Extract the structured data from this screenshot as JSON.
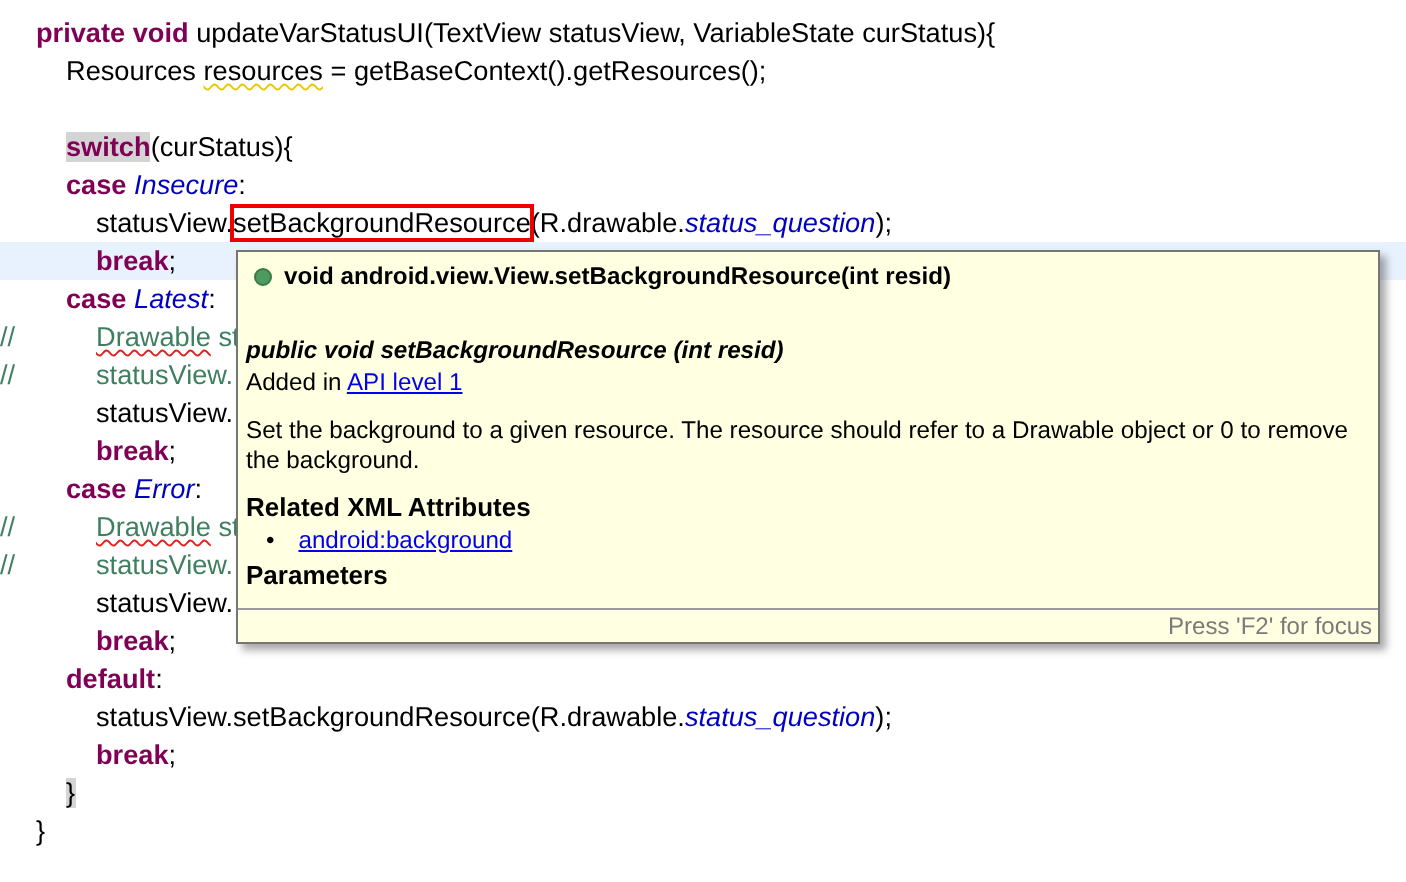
{
  "editor": {
    "lines": [
      {
        "current": false,
        "segments": [
          {
            "kind": "keyword",
            "text": "private void"
          },
          {
            "kind": "plain",
            "text": " updateVarStatusUI(TextView statusView, VariableState curStatus){"
          }
        ],
        "children": [
          {
            "current": false,
            "segments": [
              {
                "kind": "plain",
                "text": "Resources "
              },
              {
                "kind": "plain",
                "text": "resources",
                "warning": true
              },
              {
                "kind": "plain",
                "text": " = getBaseContext().getResources();"
              }
            ]
          },
          {
            "current": false
          },
          {
            "current": false,
            "segments": [
              {
                "kind": "keyword",
                "text": "switch",
                "highlighted": true
              },
              {
                "kind": "plain",
                "text": "(curStatus){"
              }
            ]
          },
          {
            "current": false,
            "segments": [
              {
                "kind": "keyword",
                "text": "case "
              },
              {
                "kind": "constant",
                "text": "Insecure"
              },
              {
                "kind": "plain",
                "text": ":"
              }
            ],
            "children": [
              {
                "current": false,
                "segments": [
                  {
                    "kind": "plain",
                    "text": "statusView."
                  },
                  {
                    "kind": "plain",
                    "text": "setBackgroundResource",
                    "boxed": true
                  },
                  {
                    "kind": "plain",
                    "text": "(R.drawable."
                  },
                  {
                    "kind": "constant",
                    "text": "status_question"
                  },
                  {
                    "kind": "plain",
                    "text": ");"
                  }
                ]
              },
              {
                "current": true,
                "segments": [
                  {
                    "kind": "keyword",
                    "text": "break"
                  },
                  {
                    "kind": "plain",
                    "text": ";"
                  }
                ]
              }
            ]
          },
          {
            "current": false,
            "segments": [
              {
                "kind": "keyword",
                "text": "case "
              },
              {
                "kind": "constant",
                "text": "Latest"
              },
              {
                "kind": "plain",
                "text": ":"
              }
            ],
            "children": [
              {
                "current": false,
                "prefix": "//",
                "segments": [
                  {
                    "kind": "comment",
                    "text": "Drawable",
                    "misspelled": true
                  },
                  {
                    "kind": "comment",
                    "text": " st"
                  }
                ]
              },
              {
                "current": false,
                "prefix": "//",
                "segments": [
                  {
                    "kind": "comment",
                    "text": "statusView."
                  }
                ]
              },
              {
                "current": false,
                "segments": [
                  {
                    "kind": "plain",
                    "text": "statusView."
                  }
                ]
              },
              {
                "current": false,
                "segments": [
                  {
                    "kind": "keyword",
                    "text": "break"
                  },
                  {
                    "kind": "plain",
                    "text": ";"
                  }
                ]
              }
            ]
          },
          {
            "current": false,
            "segments": [
              {
                "kind": "keyword",
                "text": "case "
              },
              {
                "kind": "constant",
                "text": "Error"
              },
              {
                "kind": "plain",
                "text": ":"
              }
            ],
            "children": [
              {
                "current": false,
                "prefix": "//",
                "segments": [
                  {
                    "kind": "comment",
                    "text": "Drawable",
                    "misspelled": true
                  },
                  {
                    "kind": "comment",
                    "text": " st"
                  }
                ]
              },
              {
                "current": false,
                "prefix": "//",
                "segments": [
                  {
                    "kind": "comment",
                    "text": "statusView."
                  }
                ]
              },
              {
                "current": false,
                "segments": [
                  {
                    "kind": "plain",
                    "text": "statusView."
                  }
                ]
              },
              {
                "current": false,
                "segments": [
                  {
                    "kind": "keyword",
                    "text": "break"
                  },
                  {
                    "kind": "plain",
                    "text": ";"
                  }
                ]
              }
            ]
          },
          {
            "current": false,
            "segments": [
              {
                "kind": "keyword",
                "text": "default"
              },
              {
                "kind": "plain",
                "text": ":"
              }
            ],
            "children": [
              {
                "current": false,
                "segments": [
                  {
                    "kind": "plain",
                    "text": "statusView.setBackgroundResource(R.drawable."
                  },
                  {
                    "kind": "constant",
                    "text": "status_question"
                  },
                  {
                    "kind": "plain",
                    "text": ");"
                  }
                ]
              },
              {
                "current": false,
                "segments": [
                  {
                    "kind": "keyword",
                    "text": "break"
                  },
                  {
                    "kind": "plain",
                    "text": ";"
                  }
                ]
              }
            ]
          },
          {
            "current": false,
            "segments": [
              {
                "kind": "plain",
                "text": "}",
                "highlighted": true
              }
            ]
          }
        ]
      },
      {
        "current": false,
        "segments": [
          {
            "kind": "plain",
            "text": "}"
          }
        ]
      }
    ]
  },
  "hover_popup": {
    "signature": "void android.view.View.setBackgroundResource(int resid)",
    "heading": "public void setBackgroundResource (int resid)",
    "added_prefix": "Added in ",
    "added_link": "API level 1",
    "description": "Set the background to a given resource. The resource should refer to a Drawable object or 0 to remove the background.",
    "section": "Related XML Attributes",
    "attributes": [
      {
        "marker": "•",
        "link": "android:background"
      }
    ],
    "next_section": "Parameters",
    "footer": "Press 'F2' for focus"
  }
}
